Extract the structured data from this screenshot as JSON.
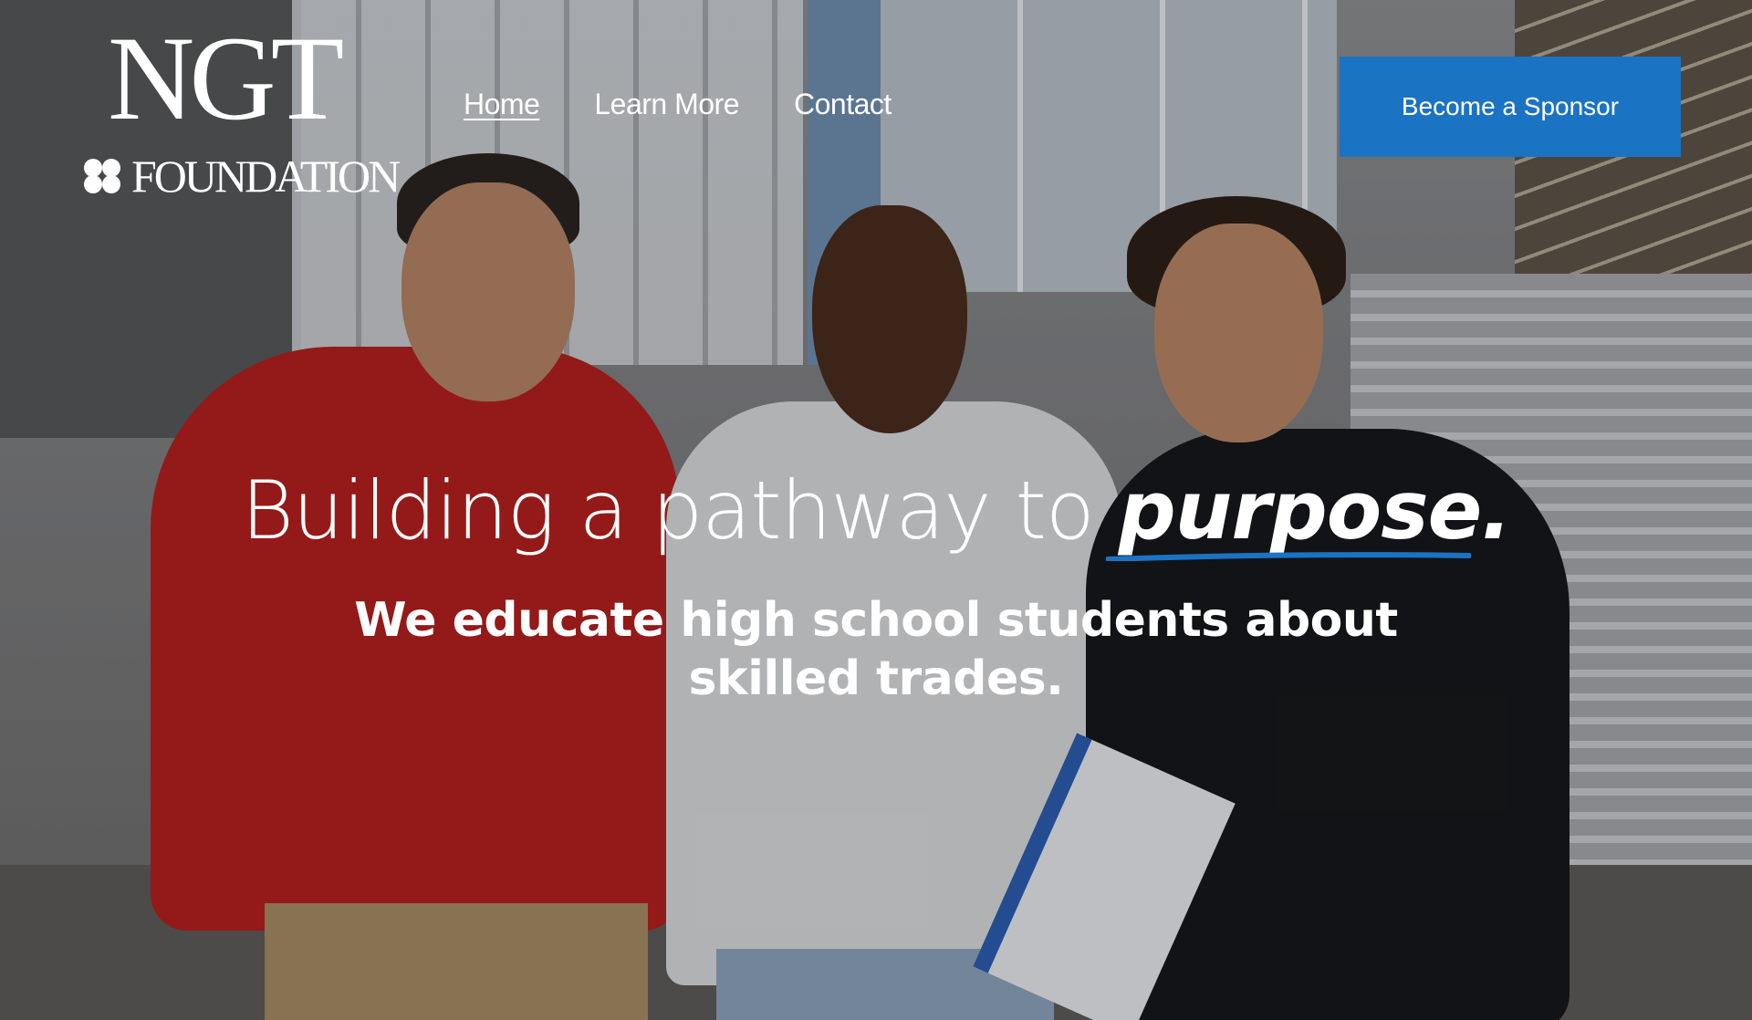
{
  "logo": {
    "main": "NGT",
    "sub": "FOUNDATION"
  },
  "nav": {
    "items": [
      {
        "label": "Home",
        "active": true
      },
      {
        "label": "Learn More",
        "active": false
      },
      {
        "label": "Contact",
        "active": false
      }
    ]
  },
  "cta": {
    "label": "Become a Sponsor",
    "color": "#1b73c4"
  },
  "hero": {
    "headline_prefix": "Building a pathway to ",
    "headline_emphasis": "purpose.",
    "subheadline": "We educate high school students about skilled trades.",
    "accent_color": "#1b73c4"
  }
}
